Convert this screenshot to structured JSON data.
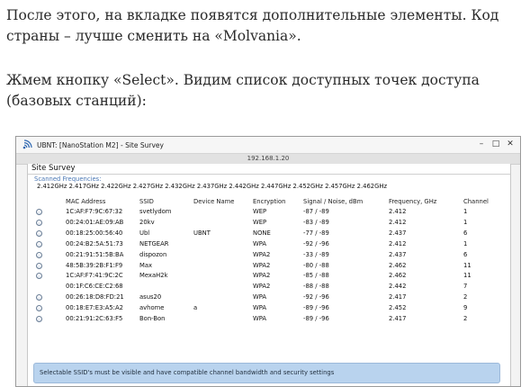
{
  "article": {
    "paragraph1": "После этого, на вкладке появятся дополнительные элементы. Код страны – лучше сменить на «Molvania».",
    "paragraph2": "Жмем кнопку «Select». Видим список доступных точек доступа (базовых станций):"
  },
  "window": {
    "title": "UBNT: [NanoStation M2] - Site Survey",
    "address": "192.168.1.20",
    "controls": {
      "minimize": "–",
      "maximize": "□",
      "close": "✕"
    },
    "icon": "antenna-signal-icon"
  },
  "survey": {
    "section_title": "Site Survey",
    "scanned_label": "Scanned Frequencies:",
    "scanned_frequencies": "2.412GHz 2.417GHz 2.422GHz 2.427GHz 2.432GHz 2.437GHz 2.442GHz 2.447GHz 2.452GHz 2.457GHz 2.462GHz",
    "columns": [
      "MAC Address",
      "SSID",
      "Device Name",
      "Encryption",
      "Signal / Noise, dBm",
      "Frequency, GHz",
      "Channel"
    ],
    "rows": [
      {
        "mac": "1C:AF:F7:9C:67:32",
        "ssid": "svetlydom",
        "device": "",
        "enc": "WEP",
        "signal": "-87 / -89",
        "freq": "2.412",
        "chan": "1",
        "selectable": true
      },
      {
        "mac": "00:24:01:AE:09:AB",
        "ssid": "20kv",
        "device": "",
        "enc": "WEP",
        "signal": "-83 / -89",
        "freq": "2.412",
        "chan": "1",
        "selectable": true
      },
      {
        "mac": "00:18:25:00:56:40",
        "ssid": "Ubl",
        "device": "UBNT",
        "enc": "NONE",
        "signal": "-77 / -89",
        "freq": "2.437",
        "chan": "6",
        "selectable": true
      },
      {
        "mac": "00:24:B2:5A:51:73",
        "ssid": "NETGEAR",
        "device": "",
        "enc": "WPA",
        "signal": "-92 / -96",
        "freq": "2.412",
        "chan": "1",
        "selectable": true
      },
      {
        "mac": "00:21:91:51:5B:BA",
        "ssid": "dispozon",
        "device": "",
        "enc": "WPA2",
        "signal": "-33 / -89",
        "freq": "2.437",
        "chan": "6",
        "selectable": true
      },
      {
        "mac": "48:5B:39:2B:F1:F9",
        "ssid": "Max",
        "device": "",
        "enc": "WPA2",
        "signal": "-80 / -88",
        "freq": "2.462",
        "chan": "11",
        "selectable": true
      },
      {
        "mac": "1C:AF:F7:41:9C:2C",
        "ssid": "MexaH2k",
        "device": "",
        "enc": "WPA2",
        "signal": "-85 / -88",
        "freq": "2.462",
        "chan": "11",
        "selectable": true
      },
      {
        "mac": "00:1F:C6:CE:C2:68",
        "ssid": "",
        "device": "",
        "enc": "WPA2",
        "signal": "-88 / -88",
        "freq": "2.442",
        "chan": "7",
        "selectable": false
      },
      {
        "mac": "00:26:18:D8:FD:21",
        "ssid": "asus20",
        "device": "",
        "enc": "WPA",
        "signal": "-92 / -96",
        "freq": "2.417",
        "chan": "2",
        "selectable": true
      },
      {
        "mac": "00:18:E7:E3:A5:A2",
        "ssid": "avhome",
        "device": "a",
        "enc": "WPA",
        "signal": "-89 / -96",
        "freq": "2.452",
        "chan": "9",
        "selectable": true
      },
      {
        "mac": "00:21:91:2C:63:F5",
        "ssid": "Bon-Bon",
        "device": "",
        "enc": "WPA",
        "signal": "-89 / -96",
        "freq": "2.417",
        "chan": "2",
        "selectable": true
      }
    ],
    "note": "Selectable SSID's must be visible and have compatible channel bandwidth and security settings"
  }
}
